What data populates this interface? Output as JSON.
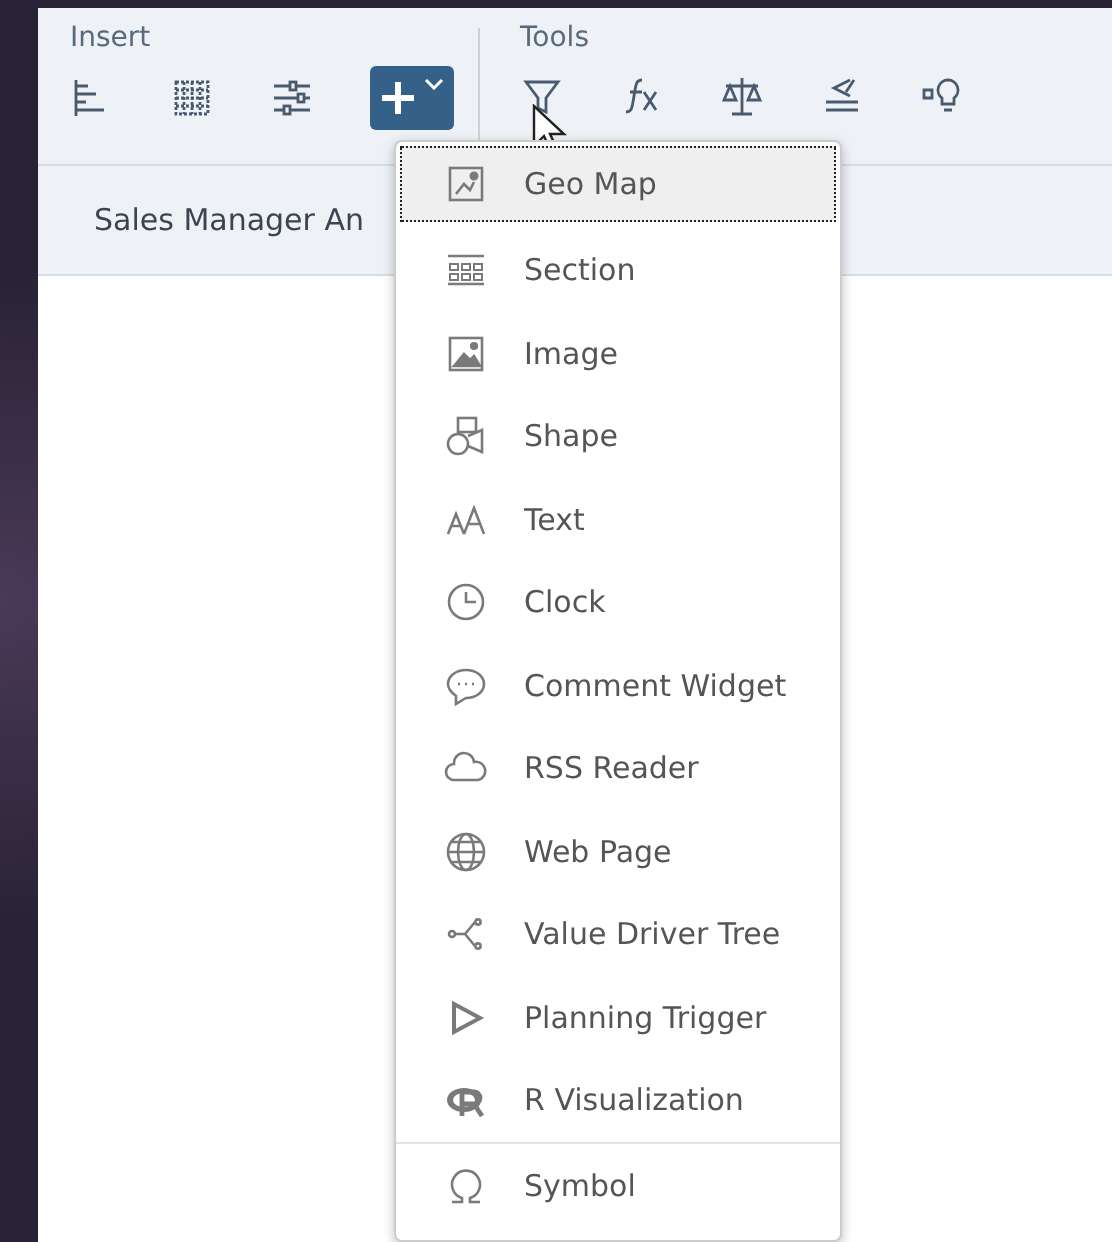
{
  "toolbar": {
    "groups": [
      {
        "title": "Insert",
        "tools": [
          {
            "kind": "chart"
          },
          {
            "kind": "table"
          },
          {
            "kind": "input-control"
          },
          {
            "kind": "add",
            "selected": true
          }
        ]
      },
      {
        "title": "Tools",
        "tools": [
          {
            "kind": "filter"
          },
          {
            "kind": "formula"
          },
          {
            "kind": "scale"
          },
          {
            "kind": "compare"
          },
          {
            "kind": "bulb"
          }
        ]
      }
    ]
  },
  "page_tab": {
    "label": "Sales Manager An"
  },
  "menu": {
    "groups": [
      [
        {
          "label": "Geo Map",
          "kind": "geomap",
          "selected": true
        },
        {
          "label": "Section",
          "kind": "section",
          "selected": false
        },
        {
          "label": "Image",
          "kind": "image",
          "selected": false
        },
        {
          "label": "Shape",
          "kind": "shape",
          "selected": false
        },
        {
          "label": "Text",
          "kind": "text",
          "selected": false
        },
        {
          "label": "Clock",
          "kind": "clock",
          "selected": false
        },
        {
          "label": "Comment Widget",
          "kind": "comment",
          "selected": false
        },
        {
          "label": "RSS Reader",
          "kind": "cloud",
          "selected": false
        },
        {
          "label": "Web Page",
          "kind": "globe",
          "selected": false
        },
        {
          "label": "Value Driver Tree",
          "kind": "tree",
          "selected": false
        },
        {
          "label": "Planning Trigger",
          "kind": "play",
          "selected": false
        },
        {
          "label": "R Visualization",
          "kind": "r",
          "selected": false
        }
      ],
      [
        {
          "label": "Symbol",
          "kind": "omega",
          "selected": false
        }
      ]
    ]
  }
}
